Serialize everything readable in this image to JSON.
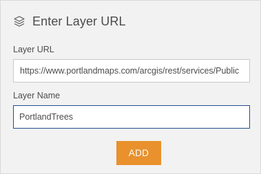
{
  "header": {
    "icon": "layers-icon",
    "title": "Enter Layer URL"
  },
  "form": {
    "url_label": "Layer URL",
    "url_value": "https://www.portlandmaps.com/arcgis/rest/services/Public",
    "name_label": "Layer Name",
    "name_value": "PortlandTrees"
  },
  "actions": {
    "add_label": "ADD"
  },
  "colors": {
    "panel_bg": "#f2f2f2",
    "accent": "#e8912d",
    "focus_border": "#1f4f8a",
    "text": "#4c4c4c"
  }
}
